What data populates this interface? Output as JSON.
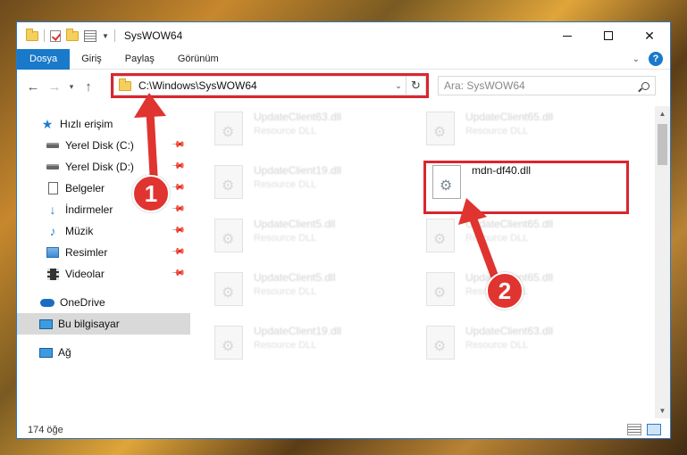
{
  "window": {
    "title": "SysWOW64",
    "controls": {
      "minimize": "minimize",
      "maximize": "maximize",
      "close": "✕"
    }
  },
  "ribbon": {
    "tabs": [
      "Dosya",
      "Giriş",
      "Paylaş",
      "Görünüm"
    ],
    "help": "?"
  },
  "navigation": {
    "back": "←",
    "forward": "→",
    "recent": "▾",
    "up": "↑",
    "address": "C:\\Windows\\SysWOW64",
    "refresh": "↻",
    "search_placeholder": "Ara: SysWOW64"
  },
  "sidebar": {
    "items": [
      {
        "label": "Hızlı erişim",
        "icon": "star-icon"
      },
      {
        "label": "Yerel Disk (C:)",
        "icon": "disk-icon",
        "pinned": true
      },
      {
        "label": "Yerel Disk (D:)",
        "icon": "disk-icon",
        "pinned": true
      },
      {
        "label": "Belgeler",
        "icon": "documents-icon",
        "pinned": true
      },
      {
        "label": "İndirmeler",
        "icon": "download-icon",
        "pinned": true
      },
      {
        "label": "Müzik",
        "icon": "music-icon",
        "pinned": true
      },
      {
        "label": "Resimler",
        "icon": "pictures-icon",
        "pinned": true
      },
      {
        "label": "Videolar",
        "icon": "videos-icon",
        "pinned": true
      },
      {
        "label": "OneDrive",
        "icon": "cloud-icon"
      },
      {
        "label": "Bu bilgisayar",
        "icon": "computer-icon",
        "selected": true
      },
      {
        "label": "Ağ",
        "icon": "network-icon"
      }
    ]
  },
  "files": [
    {
      "name": "UpdateClient63.dll",
      "type": "Resource DLL"
    },
    {
      "name": "UpdateClient65.dll",
      "type": "Resource DLL"
    },
    {
      "name": "UpdateClient19.dll",
      "type": "Resource DLL"
    },
    {
      "name": "mdn-df40.dll",
      "type": ""
    },
    {
      "name": "UpdateClient5.dll",
      "type": "Resource DLL"
    },
    {
      "name": "UpdateClient65.dll",
      "type": "Resource DLL"
    },
    {
      "name": "UpdateClient5.dll",
      "type": "Resource DLL"
    },
    {
      "name": "UpdateClient65.dll",
      "type": "Resource DLL"
    },
    {
      "name": "UpdateClient19.dll",
      "type": "Resource DLL"
    },
    {
      "name": "UpdateClient63.dll",
      "type": "Resource DLL"
    }
  ],
  "status": {
    "count": "174 öğe"
  },
  "annotations": {
    "badge1": "1",
    "badge2": "2",
    "highlight_color": "#d9262f"
  }
}
